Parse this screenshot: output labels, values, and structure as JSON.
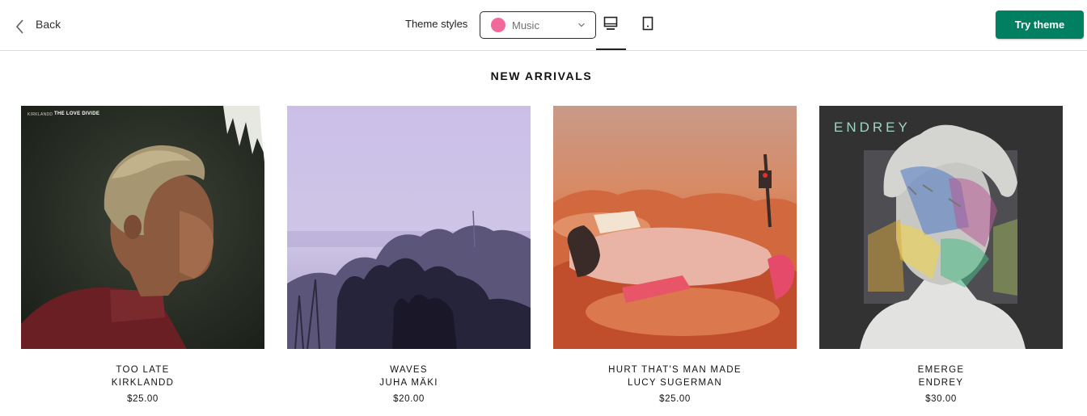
{
  "header": {
    "back_label": "Back",
    "theme_styles_label": "Theme styles",
    "theme_select": {
      "value": "Music",
      "swatch_color": "#f1689a"
    },
    "view_toggle": {
      "options": [
        "desktop-icon",
        "mobile-icon"
      ],
      "selected": "desktop"
    },
    "try_button_label": "Try theme",
    "accent_color": "#008060"
  },
  "section": {
    "title": "NEW ARRIVALS",
    "products": [
      {
        "title": "TOO LATE",
        "artist": "KIRKLANDD",
        "price": "$25.00",
        "cover_text_1": "KIRKLANDD",
        "cover_text_2": "THE LOVE DIVIDE"
      },
      {
        "title": "WAVES",
        "artist": "JUHA MÄKI",
        "price": "$20.00"
      },
      {
        "title": "HURT THAT'S MAN MADE",
        "artist": "LUCY SUGERMAN",
        "price": "$25.00"
      },
      {
        "title": "EMERGE",
        "artist": "ENDREY",
        "price": "$30.00",
        "cover_text": "ENDREY"
      }
    ]
  }
}
